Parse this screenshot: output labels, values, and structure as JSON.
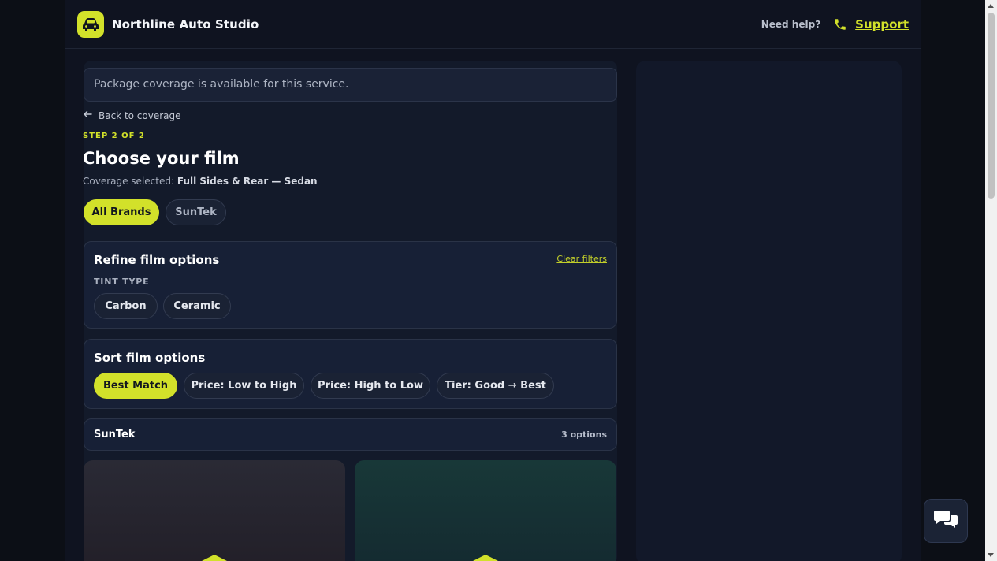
{
  "header": {
    "brand_name": "Northline Auto Studio",
    "help_text": "Need help?",
    "support_label": "Support",
    "accent_color": "#d2e12a"
  },
  "notice": {
    "text": "Package coverage is available for this service."
  },
  "back_link": {
    "label": "Back to coverage"
  },
  "step": {
    "label": "STEP 2 OF 2"
  },
  "page_title": "Choose your film",
  "coverage": {
    "prefix": "Coverage selected:",
    "value": "Full Sides & Rear — Sedan"
  },
  "brand_filters": [
    {
      "label": "All Brands",
      "active": true
    },
    {
      "label": "SunTek",
      "active": false
    }
  ],
  "refine": {
    "title": "Refine film options",
    "clear_label": "Clear filters",
    "tint_type_label": "TINT TYPE",
    "tint_options": [
      "Carbon",
      "Ceramic"
    ]
  },
  "sort": {
    "title": "Sort film options",
    "options": [
      {
        "label": "Best Match",
        "active": true
      },
      {
        "label": "Price: Low to High",
        "active": false
      },
      {
        "label": "Price: High to Low",
        "active": false
      },
      {
        "label": "Tier: Good → Best",
        "active": false
      }
    ]
  },
  "brand_group": {
    "name": "SunTek",
    "count": "3 options"
  },
  "icons": {
    "logo": "car-icon",
    "support": "phone-icon",
    "back": "arrow-left-icon",
    "chat": "chat-bubbles-icon"
  }
}
